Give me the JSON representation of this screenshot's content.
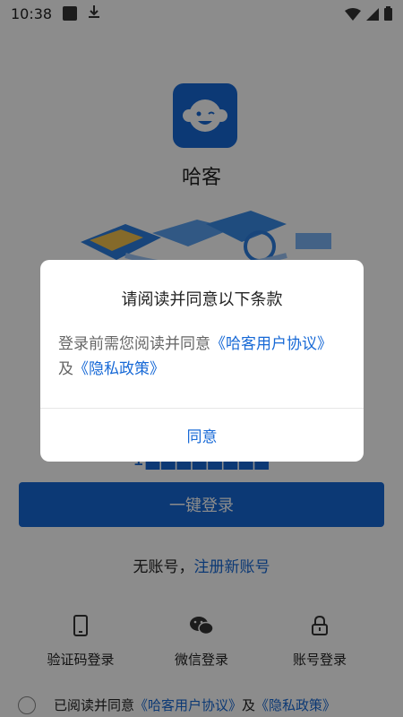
{
  "status_bar": {
    "time": "10:38"
  },
  "app": {
    "name": "哈客"
  },
  "login": {
    "phone_masked": "1▇▇▇▇▇▇▇▇",
    "one_click_label": "一键登录",
    "no_account_text": "无账号，",
    "register_link": "注册新账号"
  },
  "alt_logins": {
    "sms": {
      "label": "验证码登录",
      "icon": "phone-icon"
    },
    "wechat": {
      "label": "微信登录",
      "icon": "wechat-icon"
    },
    "account": {
      "label": "账号登录",
      "icon": "lock-icon"
    }
  },
  "agreement": {
    "prefix": "已阅读并同意",
    "user_agreement": "《哈客用户协议》",
    "and": "及",
    "privacy_policy": "《隐私政策》"
  },
  "dialog": {
    "title": "请阅读并同意以下条款",
    "body_prefix": "登录前需您阅读并同意",
    "user_agreement": "《哈客用户协议》",
    "and": "及",
    "privacy_policy": "《隐私政策》",
    "agree_button": "同意"
  },
  "colors": {
    "accent": "#1769d6",
    "overlay": "rgba(0,0,0,0.45)"
  }
}
